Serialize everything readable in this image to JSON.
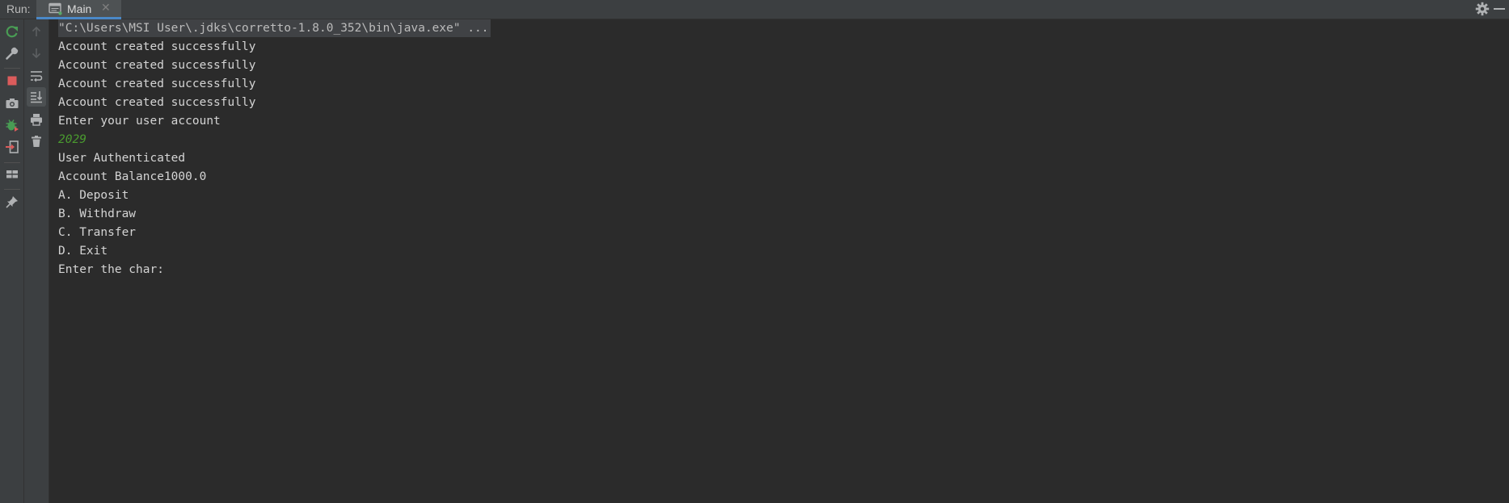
{
  "header": {
    "run_label": "Run:",
    "tab_label": "Main",
    "tab_close": "✕"
  },
  "toolbar_left": [
    {
      "name": "rerun-icon",
      "color": "#499c54"
    },
    {
      "name": "wrench-icon",
      "color": "#afb1b3"
    },
    {
      "name": "stop-icon",
      "color": "#db5c5c"
    },
    {
      "name": "camera-icon",
      "color": "#afb1b3"
    },
    {
      "name": "debug-bug-icon",
      "color": "#499c54"
    },
    {
      "name": "exit-icon",
      "color": "#db5c5c"
    },
    {
      "name": "layout-icon",
      "color": "#afb1b3"
    },
    {
      "name": "pin-icon",
      "color": "#afb1b3"
    }
  ],
  "toolbar_right": [
    {
      "name": "up-arrow-icon",
      "color": "#5d6062"
    },
    {
      "name": "down-arrow-icon",
      "color": "#5d6062"
    },
    {
      "name": "soft-wrap-icon",
      "color": "#afb1b3"
    },
    {
      "name": "scroll-to-end-icon",
      "color": "#afb1b3"
    },
    {
      "name": "print-icon",
      "color": "#afb1b3"
    },
    {
      "name": "trash-icon",
      "color": "#afb1b3"
    }
  ],
  "console": {
    "lines": [
      {
        "text": "\"C:\\Users\\MSI User\\.jdks\\corretto-1.8.0_352\\bin\\java.exe\" ...",
        "type": "cmd"
      },
      {
        "text": "Account created successfully",
        "type": "out"
      },
      {
        "text": "Account created successfully",
        "type": "out"
      },
      {
        "text": "Account created successfully",
        "type": "out"
      },
      {
        "text": "Account created successfully",
        "type": "out"
      },
      {
        "text": "Enter your user account",
        "type": "out"
      },
      {
        "text": "2029",
        "type": "input"
      },
      {
        "text": "User Authenticated",
        "type": "out"
      },
      {
        "text": "Account Balance1000.0",
        "type": "out"
      },
      {
        "text": "A. Deposit",
        "type": "out"
      },
      {
        "text": "B. Withdraw",
        "type": "out"
      },
      {
        "text": "C. Transfer",
        "type": "out"
      },
      {
        "text": "D. Exit",
        "type": "out"
      },
      {
        "text": "Enter the char:",
        "type": "out"
      }
    ]
  },
  "colors": {
    "output_text": "#d4d4d4",
    "user_input": "#4a9a2f",
    "background": "#2b2b2b",
    "panel": "#3c3f41",
    "accent": "#4a88c7"
  }
}
